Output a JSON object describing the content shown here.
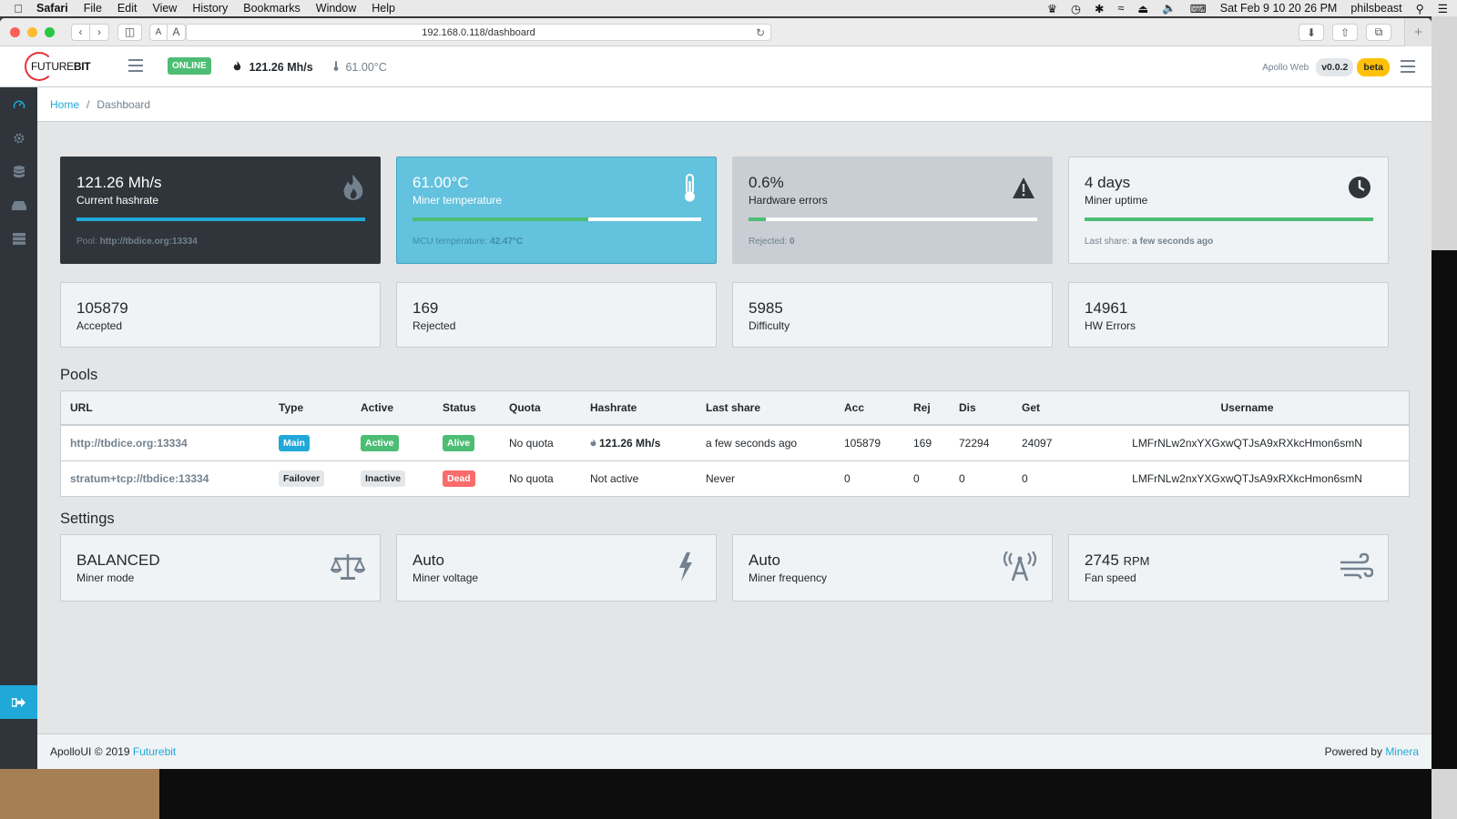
{
  "menubar": {
    "apple_icon": "apple-icon",
    "app_name": "Safari",
    "items": [
      "File",
      "Edit",
      "View",
      "History",
      "Bookmarks",
      "Window",
      "Help"
    ],
    "datetime": "Sat Feb 9  10 20 26 PM",
    "user": "philsbeast"
  },
  "browser": {
    "url": "192.168.0.118/dashboard",
    "font_small": "A",
    "font_large": "A",
    "new_tab": "+"
  },
  "header": {
    "logo_main": "FUTURE",
    "logo_bold": "BIT",
    "status": "ONLINE",
    "hashrate": "121.26 Mh/s",
    "temperature": "61.00°C",
    "app_name": "Apollo Web",
    "version": "v0.0.2",
    "beta": "beta"
  },
  "breadcrumb": {
    "home": "Home",
    "separator": "/",
    "current": "Dashboard"
  },
  "stat_cards": [
    {
      "value": "121.26 Mh/s",
      "label": "Current hashrate",
      "foot_label": "Pool:",
      "foot_value": "http://tbdice.org:13334",
      "progress": 1.0,
      "icon": "flame-icon"
    },
    {
      "value": "61.00°C",
      "label": "Miner temperature",
      "foot_label": "MCU temperature:",
      "foot_value": "42.47°C",
      "progress": 0.61,
      "icon": "thermometer-icon"
    },
    {
      "value": "0.6%",
      "label": "Hardware errors",
      "foot_label": "Rejected:",
      "foot_value": "0",
      "progress": 0.06,
      "icon": "warning-icon"
    },
    {
      "value": "4 days",
      "label": "Miner uptime",
      "foot_label": "Last share:",
      "foot_value": "a few seconds ago",
      "progress": 1.0,
      "icon": "clock-icon"
    }
  ],
  "counter_cards": [
    {
      "value": "105879",
      "label": "Accepted"
    },
    {
      "value": "169",
      "label": "Rejected"
    },
    {
      "value": "5985",
      "label": "Difficulty"
    },
    {
      "value": "14961",
      "label": "HW Errors"
    }
  ],
  "pools": {
    "title": "Pools",
    "columns": [
      "URL",
      "Type",
      "Active",
      "Status",
      "Quota",
      "Hashrate",
      "Last share",
      "Acc",
      "Rej",
      "Dis",
      "Get",
      "Username"
    ],
    "rows": [
      {
        "url": "http://tbdice.org:13334",
        "type": "Main",
        "active": "Active",
        "status": "Alive",
        "quota": "No quota",
        "hashrate": "121.26 Mh/s",
        "last_share": "a few seconds ago",
        "acc": "105879",
        "rej": "169",
        "dis": "72294",
        "get": "24097",
        "username": "LMFrNLw2nxYXGxwQTJsA9xRXkcHmon6smN"
      },
      {
        "url": "stratum+tcp://tbdice:13334",
        "type": "Failover",
        "active": "Inactive",
        "status": "Dead",
        "quota": "No quota",
        "hashrate": "Not active",
        "last_share": "Never",
        "acc": "0",
        "rej": "0",
        "dis": "0",
        "get": "0",
        "username": "LMFrNLw2nxYXGxwQTJsA9xRXkcHmon6smN"
      }
    ]
  },
  "settings": {
    "title": "Settings",
    "cards": [
      {
        "value": "BALANCED",
        "unit": "",
        "label": "Miner mode",
        "icon": "balance-scale-icon"
      },
      {
        "value": "Auto",
        "unit": "",
        "label": "Miner voltage",
        "icon": "bolt-icon"
      },
      {
        "value": "Auto",
        "unit": "",
        "label": "Miner frequency",
        "icon": "broadcast-tower-icon"
      },
      {
        "value": "2745",
        "unit": "RPM",
        "label": "Fan speed",
        "icon": "wind-icon"
      }
    ]
  },
  "footer": {
    "left_text": "ApolloUI © 2019",
    "left_link": "Futurebit",
    "right_text": "Powered by",
    "right_link": "Minera"
  },
  "colors": {
    "primary": "#20a8d8",
    "success": "#4dbd74",
    "danger": "#f86c6b",
    "warning": "#ffc107",
    "info": "#63c2de",
    "dark": "#2f353a"
  }
}
